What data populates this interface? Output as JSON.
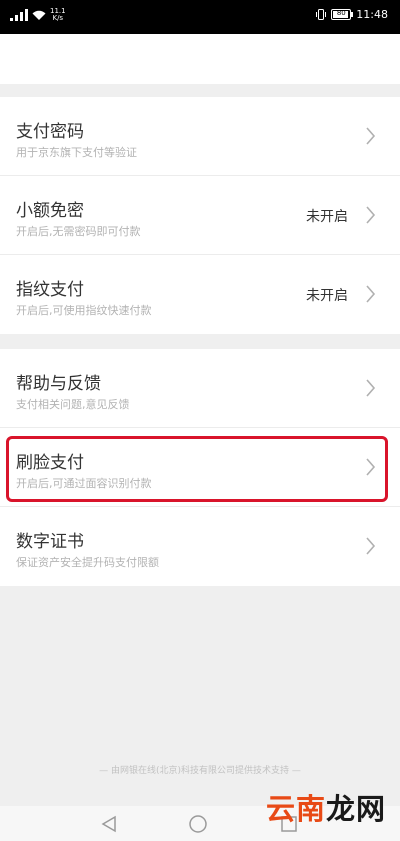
{
  "status_bar": {
    "speed_top": "11.1",
    "speed_bottom": "K/s",
    "battery": "80",
    "time": "11:48"
  },
  "sections": [
    {
      "items": [
        {
          "title": "支付密码",
          "subtitle": "用于京东旗下支付等验证",
          "status": ""
        },
        {
          "title": "小额免密",
          "subtitle": "开启后,无需密码即可付款",
          "status": "未开启"
        },
        {
          "title": "指纹支付",
          "subtitle": "开启后,可使用指纹快速付款",
          "status": "未开启"
        }
      ]
    },
    {
      "items": [
        {
          "title": "帮助与反馈",
          "subtitle": "支付相关问题,意见反馈",
          "status": ""
        },
        {
          "title": "刷脸支付",
          "subtitle": "开启后,可通过面容识别付款",
          "status": ""
        },
        {
          "title": "数字证书",
          "subtitle": "保证资产安全提升码支付限额",
          "status": ""
        }
      ]
    }
  ],
  "footer": "— 由网银在线(北京)科技有限公司提供技术支持 —",
  "watermark": {
    "part1": "云南",
    "part2": "龙网"
  },
  "colors": {
    "highlight": "#d9142b",
    "watermark_accent": "#e84a16"
  }
}
